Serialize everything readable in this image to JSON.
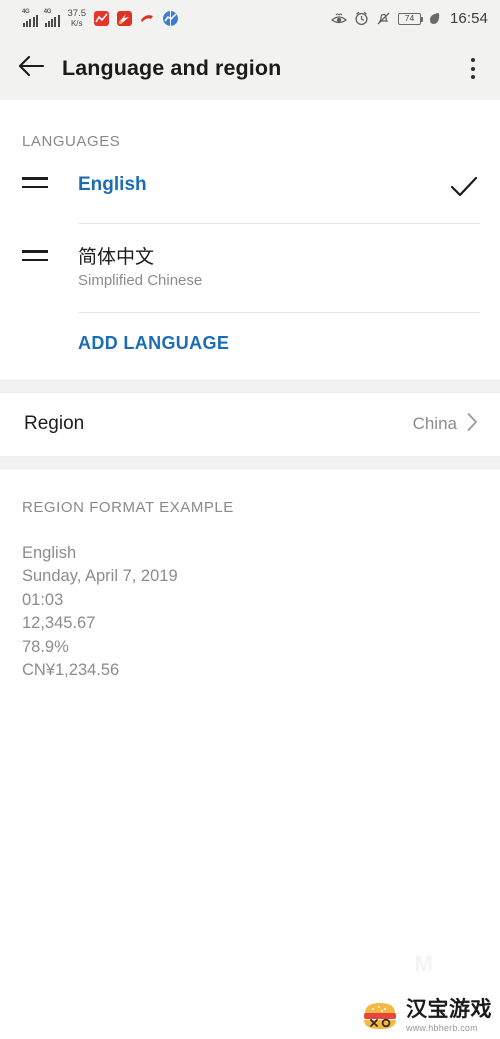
{
  "statusbar": {
    "signal1": {
      "network_label": "4G",
      "icon": "signal-bars-icon"
    },
    "signal2": {
      "network_label": "4G",
      "icon": "signal-bars-icon"
    },
    "network_speed": {
      "value": "37.5",
      "unit": "K/s"
    },
    "notification_icons": [
      "app-notification-icon-1",
      "app-notification-icon-2",
      "app-notification-icon-3",
      "app-notification-icon-4"
    ],
    "eye_comfort_icon": "eye-comfort-icon",
    "alarm_icon": "alarm-clock-icon",
    "silent_icon": "bell-muted-icon",
    "battery_level": "74",
    "power_saving_icon": "leaf-power-saving-icon",
    "time": "16:54"
  },
  "appbar": {
    "back_icon": "back-arrow-icon",
    "title": "Language and region",
    "overflow_icon": "overflow-menu-icon"
  },
  "languages": {
    "section_title": "LANGUAGES",
    "items": [
      {
        "name": "English",
        "subtitle": "",
        "selected": true,
        "drag_icon": "drag-handle-icon",
        "check_icon": "checkmark-icon"
      },
      {
        "name": "简体中文",
        "subtitle": "Simplified Chinese",
        "selected": false,
        "drag_icon": "drag-handle-icon",
        "check_icon": ""
      }
    ],
    "add_language_label": "ADD LANGUAGE",
    "accent_color": "#1c6eb4"
  },
  "region": {
    "label": "Region",
    "value": "China",
    "chevron_icon": "chevron-right-icon"
  },
  "region_format_example": {
    "section_title": "REGION FORMAT EXAMPLE",
    "lines": [
      "English",
      "Sunday, April 7, 2019",
      "01:03",
      "12,345.67",
      "78.9%",
      "CN¥1,234.56"
    ]
  },
  "watermark": {
    "faint_mark": "M",
    "title": "汉宝游戏",
    "url": "www.hbherb.com",
    "logo_icon": "burger-logo-icon"
  }
}
